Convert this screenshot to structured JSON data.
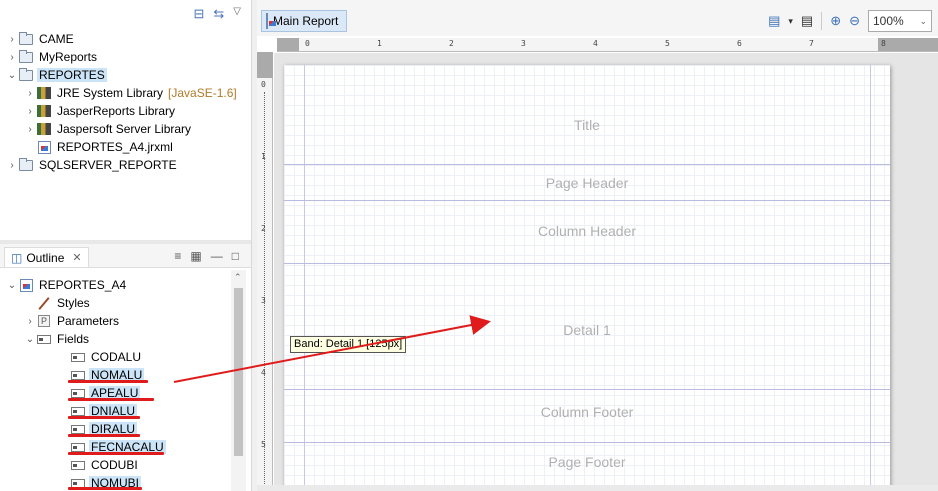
{
  "project_explorer": {
    "items": [
      {
        "label": "CAME",
        "expanded": false
      },
      {
        "label": "MyReports",
        "expanded": false
      },
      {
        "label": "REPORTES",
        "expanded": true,
        "selected": true
      },
      {
        "label": "JRE System Library",
        "decoration": "[JavaSE-1.6]"
      },
      {
        "label": "JasperReports Library"
      },
      {
        "label": "Jaspersoft Server Library"
      },
      {
        "label": "REPORTES_A4.jrxml"
      },
      {
        "label": "SQLSERVER_REPORTE",
        "expanded": false
      }
    ]
  },
  "outline": {
    "tab_label": "Outline",
    "tab_close": "✕",
    "root": "REPORTES_A4",
    "items": [
      "Styles",
      "Parameters",
      "Fields"
    ],
    "fields": [
      "CODALU",
      "NOMALU",
      "APEALU",
      "DNIALU",
      "DIRALU",
      "FECNACALU",
      "CODUBI",
      "NOMUBI"
    ],
    "highlighted_fields": [
      "NOMALU",
      "APEALU",
      "DNIALU",
      "DIRALU",
      "FECNACALU",
      "NOMUBI"
    ]
  },
  "editor": {
    "tab_label": "Main Report",
    "zoom": "100%",
    "ruler_numbers": [
      "0",
      "1",
      "2",
      "3",
      "4",
      "5",
      "6",
      "7",
      "8"
    ],
    "vruler_numbers": [
      "0",
      "1",
      "2",
      "3",
      "4",
      "5"
    ],
    "bands": [
      "Title",
      "Page Header",
      "Column Header",
      "Detail 1",
      "Column Footer",
      "Page Footer"
    ],
    "tooltip": "Band: Detail 1 [125px]"
  },
  "annotation": {
    "arrow_color": "#e01b1b",
    "underline_color": "#e01b1b"
  },
  "colors": {
    "selection": "#cce4f7",
    "band_line": "#b9bce0",
    "decoration": "#b07a2a"
  }
}
